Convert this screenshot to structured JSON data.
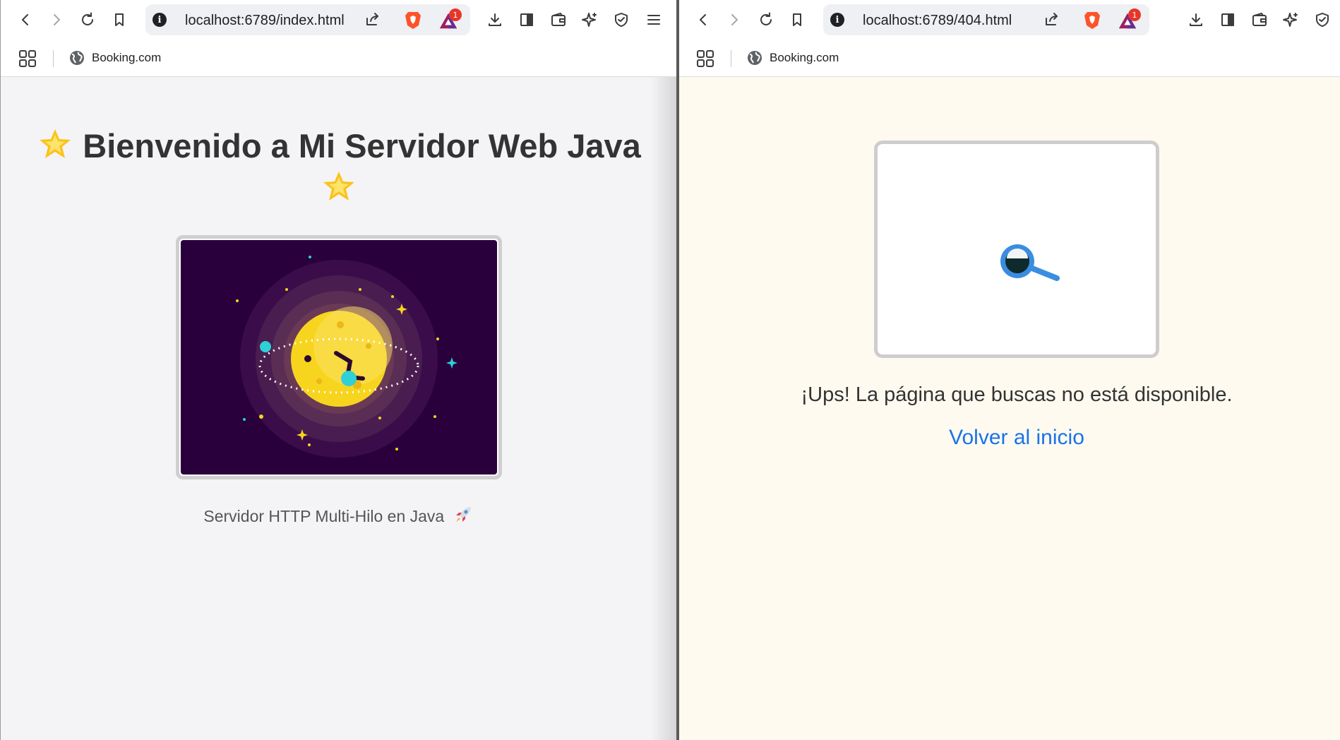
{
  "left_window": {
    "url": "localhost:6789/index.html",
    "bookmark": "Booking.com",
    "badge_count": "1",
    "page": {
      "title": "Bienvenido a Mi Servidor Web Java",
      "caption": "Servidor HTTP Multi-Hilo en Java",
      "image": "planet-orbit-illustration"
    }
  },
  "right_window": {
    "url": "localhost:6789/404.html",
    "bookmark": "Booking.com",
    "badge_count": "1",
    "page": {
      "message": "¡Ups! La página que buscas no está disponible.",
      "link": "Volver al inicio",
      "image": "magnifier-icon"
    }
  },
  "colors": {
    "link": "#1a73e8",
    "left_bg": "#f4f4f7",
    "right_bg": "#fefaf0",
    "space": "#2a003c",
    "planet": "#f7d51e"
  }
}
